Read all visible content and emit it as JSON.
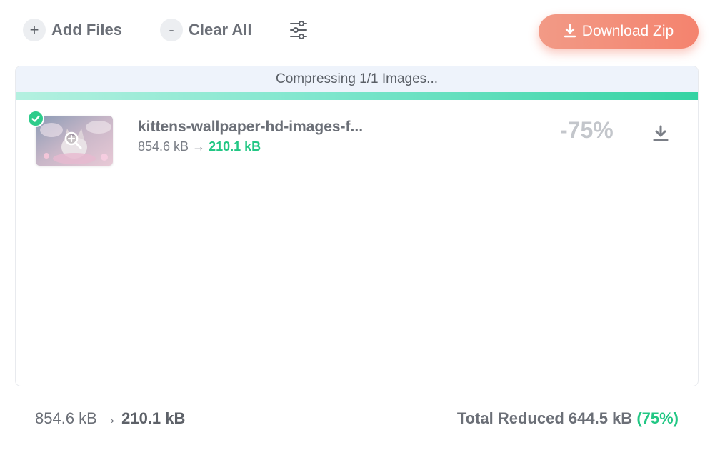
{
  "toolbar": {
    "add_files_icon": "+",
    "add_files_label": "Add Files",
    "clear_all_icon": "-",
    "clear_all_label": "Clear All",
    "settings_icon": "sliders-icon",
    "download_zip_label": "Download Zip",
    "download_zip_color": "#f4836e"
  },
  "status": {
    "text": "Compressing 1/1 Images...",
    "progress_fraction": 1.0
  },
  "files": [
    {
      "name": "kittens-wallpaper-hd-images-f...",
      "original_size": "854.6 kB",
      "arrow": "→",
      "compressed_size": "210.1 kB",
      "reduction": "-75%",
      "status": "done"
    }
  ],
  "footer": {
    "original_size": "854.6 kB",
    "arrow": "→",
    "compressed_size": "210.1 kB",
    "total_label": "Total Reduced",
    "total_value": "644.5 kB",
    "total_percent": "(75%)"
  },
  "colors": {
    "accent_green": "#22c784",
    "button_coral": "#f4836e",
    "progress_teal": "#34d3a3"
  }
}
